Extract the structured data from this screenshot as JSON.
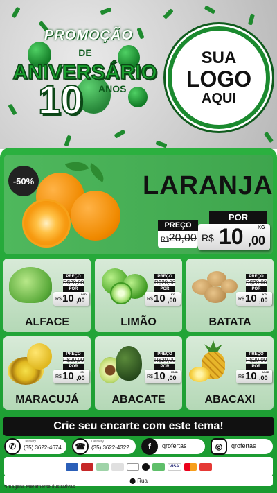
{
  "header": {
    "promo_title": "PROMOÇÃO",
    "promo_de": "DE",
    "promo_anniversary": "ANIVERSÁRIO",
    "promo_number": "10",
    "promo_years": "ANOS",
    "logo_line1": "SUA",
    "logo_line2": "LOGO",
    "logo_line3": "AQUI"
  },
  "featured": {
    "badge": "-50%",
    "name": "LARANJA",
    "preco_label": "PREÇO",
    "old_currency": "R$",
    "old_price": "20,00",
    "por_label": "POR",
    "currency": "R$",
    "price_int": "10",
    "price_dec": ",00",
    "unit": "KG"
  },
  "products": [
    {
      "name": "ALFACE",
      "preco_label": "PREÇO",
      "old_price": "R$20,00",
      "por_label": "POR",
      "currency": "R$",
      "price_int": "10",
      "price_dec": ",00",
      "unit": "UNID"
    },
    {
      "name": "LIMÃO",
      "preco_label": "PREÇO",
      "old_price": "R$20,00",
      "por_label": "POR",
      "currency": "R$",
      "price_int": "10",
      "price_dec": ",00",
      "unit": "KG"
    },
    {
      "name": "BATATA",
      "preco_label": "PREÇO",
      "old_price": "R$20,00",
      "por_label": "POR",
      "currency": "R$",
      "price_int": "10",
      "price_dec": ",00",
      "unit": "KG"
    },
    {
      "name": "MARACUJÁ",
      "preco_label": "PREÇO",
      "old_price": "R$20,00",
      "por_label": "POR",
      "currency": "R$",
      "price_int": "10",
      "price_dec": ",00",
      "unit": "KG"
    },
    {
      "name": "ABACATE",
      "preco_label": "PREÇO",
      "old_price": "R$20,00",
      "por_label": "POR",
      "currency": "R$",
      "price_int": "10",
      "price_dec": ",00",
      "unit": "UNID"
    },
    {
      "name": "ABACAXI",
      "preco_label": "PREÇO",
      "old_price": "R$20,00",
      "por_label": "POR",
      "currency": "R$",
      "price_int": "10",
      "price_dec": ",00",
      "unit": "UNID"
    }
  ],
  "cta": "Crie seu encarte com este tema!",
  "footer": {
    "delivery_label": "Delivery",
    "whatsapp": "(35) 3622-4674",
    "phone": "(35) 3622-4322",
    "facebook": "qrofertas",
    "instagram": "qrofertas",
    "address": "Rua",
    "disclaimer": "*Imagens Meramente Ilustrativas"
  },
  "colors": {
    "brand_green": "#1b8a2f",
    "panel_green": "#2bb03f",
    "dark": "#111111"
  },
  "icons": [
    "whatsapp-icon",
    "phone-icon",
    "facebook-icon",
    "instagram-icon",
    "location-pin-icon"
  ]
}
